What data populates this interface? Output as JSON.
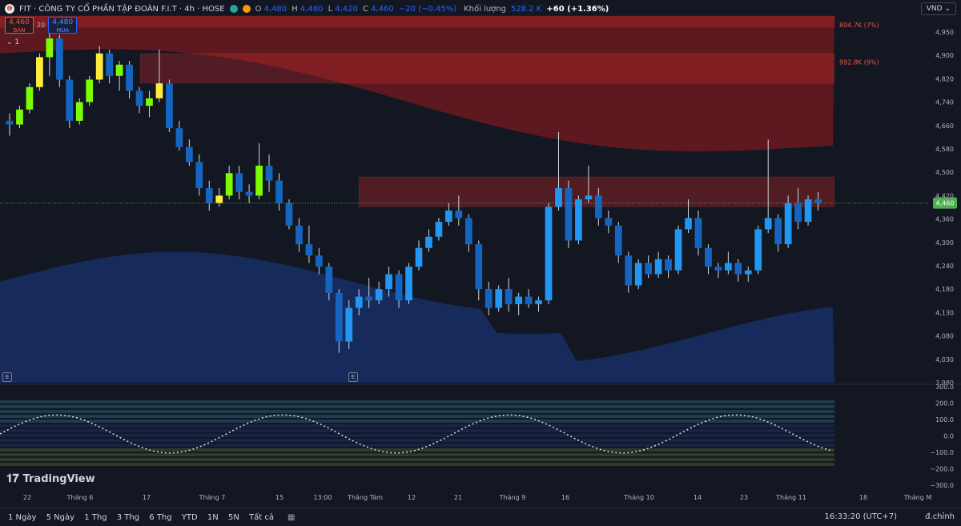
{
  "header": {
    "symbol_line": "FIT · CÔNG TY CỔ PHẦN TẬP ĐOÀN F.I.T · 4h · HOSE",
    "o_label": "O",
    "o": "4,480",
    "h_label": "H",
    "h": "4,480",
    "l_label": "L",
    "l": "4,420",
    "c_label": "C",
    "c": "4,460",
    "change": "−20 (−0.45%)",
    "volume_label": "Khối lượng",
    "volume": "528.2 K",
    "plus": "+60 (+1.36%)"
  },
  "trade": {
    "sell_price": "4,460",
    "sell_label": "BÁN",
    "spread": "20",
    "buy_price": "4,480",
    "buy_label": "MUA"
  },
  "collapse": "1",
  "currency": "VND",
  "chart_data": {
    "type": "candlestick",
    "y_axis_ticks": [
      "4,950",
      "4,900",
      "4,820",
      "4,740",
      "4,660",
      "4,580",
      "4,500",
      "4,420",
      "4,360",
      "4,300",
      "4,240",
      "4,180",
      "4,130",
      "4,080",
      "4,030",
      "3,980"
    ],
    "ylim": [
      3980,
      4960
    ],
    "last_price": "4,460",
    "last_price_value": 4460,
    "x_ticks": [
      "22",
      "Tháng 6",
      "17",
      "Tháng 7",
      "15",
      "13:00",
      "Tháng Tám",
      "12",
      "21",
      "Tháng 9",
      "16",
      "Tháng 10",
      "14",
      "23",
      "Tháng 11",
      "18",
      "Tháng M"
    ],
    "zones": [
      {
        "label": "804.7K (7%)",
        "top": 4960,
        "bottom": 4930
      },
      {
        "label": "992.8K (9%)",
        "top": 4860,
        "bottom": 4780
      },
      {
        "label": "",
        "top": 4530,
        "bottom": 4450
      }
    ],
    "candles": [
      [
        4680,
        4700,
        4640,
        4670
      ],
      [
        4670,
        4720,
        4660,
        4710
      ],
      [
        4710,
        4780,
        4700,
        4770
      ],
      [
        4770,
        4860,
        4760,
        4850
      ],
      [
        4850,
        4930,
        4800,
        4900
      ],
      [
        4900,
        4910,
        4770,
        4790
      ],
      [
        4790,
        4800,
        4660,
        4680
      ],
      [
        4680,
        4740,
        4670,
        4730
      ],
      [
        4730,
        4800,
        4720,
        4790
      ],
      [
        4790,
        4880,
        4780,
        4860
      ],
      [
        4860,
        4870,
        4780,
        4800
      ],
      [
        4800,
        4840,
        4760,
        4830
      ],
      [
        4830,
        4840,
        4740,
        4760
      ],
      [
        4760,
        4770,
        4700,
        4720
      ],
      [
        4720,
        4760,
        4690,
        4740
      ],
      [
        4740,
        4870,
        4730,
        4780
      ],
      [
        4780,
        4790,
        4650,
        4660
      ],
      [
        4660,
        4680,
        4600,
        4610
      ],
      [
        4610,
        4630,
        4560,
        4570
      ],
      [
        4570,
        4590,
        4480,
        4500
      ],
      [
        4500,
        4520,
        4440,
        4460
      ],
      [
        4460,
        4500,
        4450,
        4480
      ],
      [
        4480,
        4560,
        4470,
        4540
      ],
      [
        4540,
        4560,
        4470,
        4490
      ],
      [
        4490,
        4510,
        4460,
        4480
      ],
      [
        4480,
        4620,
        4470,
        4560
      ],
      [
        4560,
        4590,
        4490,
        4520
      ],
      [
        4520,
        4540,
        4440,
        4460
      ],
      [
        4460,
        4470,
        4390,
        4400
      ],
      [
        4400,
        4420,
        4330,
        4350
      ],
      [
        4350,
        4400,
        4300,
        4320
      ],
      [
        4320,
        4340,
        4270,
        4290
      ],
      [
        4290,
        4300,
        4200,
        4220
      ],
      [
        4220,
        4230,
        4060,
        4090
      ],
      [
        4090,
        4200,
        4070,
        4180
      ],
      [
        4180,
        4230,
        4160,
        4210
      ],
      [
        4210,
        4260,
        4180,
        4200
      ],
      [
        4200,
        4250,
        4190,
        4230
      ],
      [
        4230,
        4290,
        4210,
        4270
      ],
      [
        4270,
        4280,
        4180,
        4200
      ],
      [
        4200,
        4300,
        4190,
        4290
      ],
      [
        4290,
        4360,
        4280,
        4340
      ],
      [
        4340,
        4390,
        4330,
        4370
      ],
      [
        4370,
        4420,
        4360,
        4410
      ],
      [
        4410,
        4460,
        4400,
        4440
      ],
      [
        4440,
        4480,
        4400,
        4420
      ],
      [
        4420,
        4430,
        4330,
        4350
      ],
      [
        4350,
        4360,
        4200,
        4230
      ],
      [
        4230,
        4250,
        4160,
        4180
      ],
      [
        4180,
        4240,
        4170,
        4230
      ],
      [
        4230,
        4260,
        4170,
        4190
      ],
      [
        4190,
        4220,
        4160,
        4210
      ],
      [
        4210,
        4230,
        4180,
        4190
      ],
      [
        4190,
        4210,
        4170,
        4200
      ],
      [
        4200,
        4460,
        4190,
        4450
      ],
      [
        4450,
        4650,
        4440,
        4500
      ],
      [
        4500,
        4520,
        4340,
        4360
      ],
      [
        4360,
        4480,
        4350,
        4470
      ],
      [
        4470,
        4560,
        4460,
        4480
      ],
      [
        4480,
        4500,
        4400,
        4420
      ],
      [
        4420,
        4440,
        4380,
        4400
      ],
      [
        4400,
        4410,
        4300,
        4320
      ],
      [
        4320,
        4330,
        4220,
        4240
      ],
      [
        4240,
        4310,
        4230,
        4300
      ],
      [
        4300,
        4320,
        4260,
        4270
      ],
      [
        4270,
        4330,
        4260,
        4310
      ],
      [
        4310,
        4320,
        4260,
        4280
      ],
      [
        4280,
        4400,
        4270,
        4390
      ],
      [
        4390,
        4470,
        4380,
        4420
      ],
      [
        4420,
        4440,
        4320,
        4340
      ],
      [
        4340,
        4350,
        4270,
        4290
      ],
      [
        4290,
        4300,
        4260,
        4280
      ],
      [
        4280,
        4330,
        4270,
        4300
      ],
      [
        4300,
        4310,
        4250,
        4270
      ],
      [
        4270,
        4290,
        4250,
        4280
      ],
      [
        4280,
        4400,
        4270,
        4390
      ],
      [
        4390,
        4630,
        4380,
        4420
      ],
      [
        4420,
        4430,
        4330,
        4350
      ],
      [
        4350,
        4480,
        4340,
        4460
      ],
      [
        4460,
        4500,
        4390,
        4410
      ],
      [
        4410,
        4480,
        4400,
        4470
      ],
      [
        4470,
        4490,
        4440,
        4460
      ]
    ]
  },
  "indicator": {
    "ticks": [
      "300.0",
      "200.0",
      "100.0",
      "0.0",
      "−100.0",
      "−200.0",
      "−300.0"
    ],
    "ylim": [
      -300,
      300
    ]
  },
  "branding": {
    "logo_text": "TradingView"
  },
  "bottom_bar": {
    "ranges": [
      "1 Ngày",
      "5 Ngày",
      "1 Thg",
      "3 Thg",
      "6 Thg",
      "YTD",
      "1N",
      "5N",
      "Tất cả"
    ],
    "clock": "16:33:20 (UTC+7)",
    "adjust": "đ.chỉnh"
  },
  "colors": {
    "up_strong": "#7cfc00",
    "up": "#2196f3",
    "down": "#1565c0",
    "zone_red": "#b71c1c",
    "band_blue": "#1a3a8a",
    "accent": "#2962ff"
  }
}
